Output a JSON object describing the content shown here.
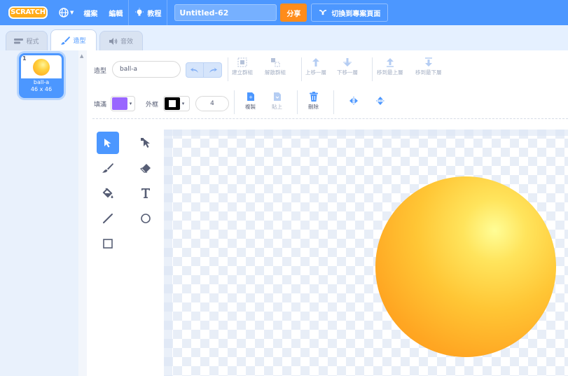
{
  "menubar": {
    "logo": "SCRATCH",
    "file": "檔案",
    "edit": "編輯",
    "tutorials": "教程",
    "project_title": "Untitled-62",
    "share": "分享",
    "see_project_page": "切換到專案頁面"
  },
  "tabs": {
    "code": "程式",
    "costumes": "造型",
    "sounds": "音效"
  },
  "costume_list": {
    "items": [
      {
        "number": "1",
        "name": "ball-a",
        "size": "46 x 46"
      }
    ]
  },
  "toolbar": {
    "costume_label": "造型",
    "costume_name": "ball-a",
    "group": "建立群組",
    "ungroup": "解散群組",
    "forward": "上移一層",
    "backward": "下移一層",
    "front": "移到最上層",
    "back": "移到最下層",
    "fill_label": "填滿",
    "outline_label": "外框",
    "stroke_width": "4",
    "copy": "複製",
    "paste": "貼上",
    "delete": "刪除",
    "fill_color": "#9966ff",
    "outline_color": "#000000"
  },
  "colors": {
    "menu_blue": "#4c97ff",
    "share_orange": "#ff8c1a"
  }
}
